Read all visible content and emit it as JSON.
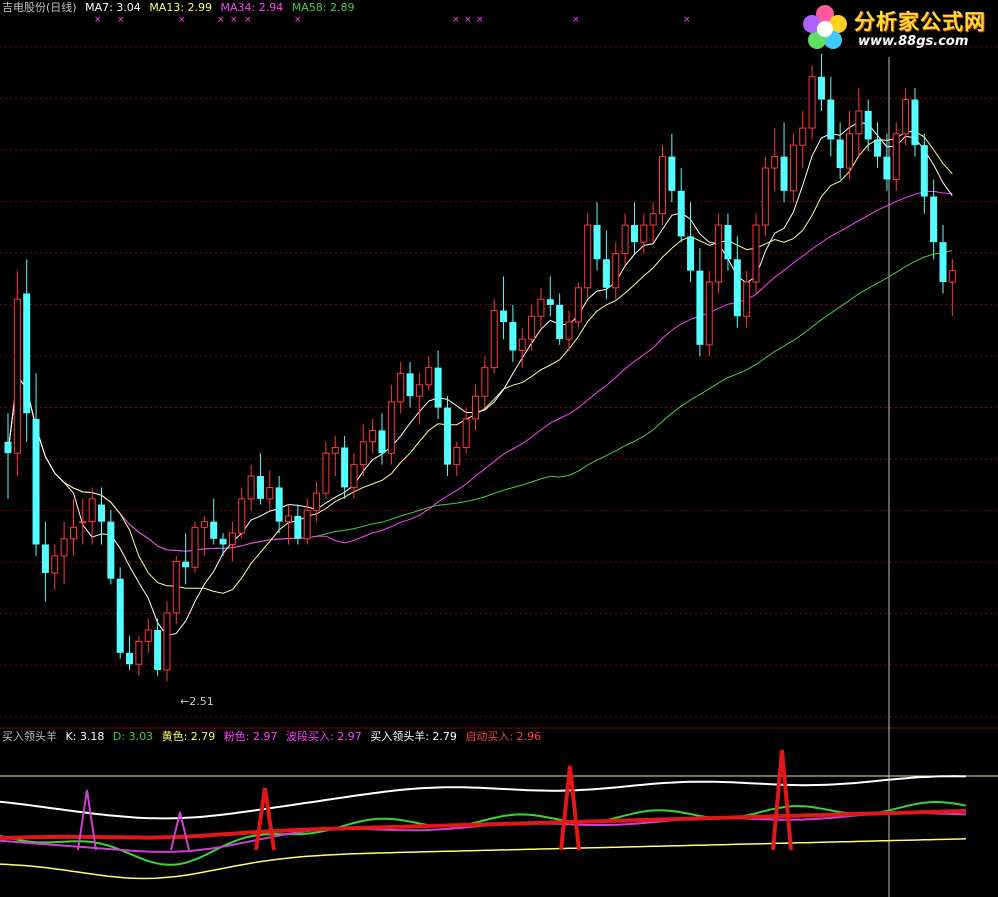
{
  "colors": {
    "up": "#ff3838",
    "down": "#54ffff",
    "ma7": "#ffffff",
    "ma13": "#ffff88",
    "ma34": "#ff40ff",
    "ma58": "#40d040",
    "grid": "#8a0000",
    "white_line": "#ffffff",
    "green_line": "#36d636",
    "yellow_line": "#ffff66",
    "pink_line": "#d040d0",
    "red_line": "#e01818"
  },
  "top_legend": {
    "title": "吉电股份(日线)",
    "ma7_label": "MA7: 3.04",
    "ma13_label": "MA13: 2.99",
    "ma34_label": "MA34: 2.94",
    "ma58_label": "MA58: 2.89"
  },
  "bottom_legend": {
    "name": "买入领头羊",
    "k_label": "K: 3.18",
    "d_label": "D: 3.03",
    "yellow_label": "黄色: 2.79",
    "pink_label": "粉色: 2.97",
    "wave_label": "波段买入: 2.97",
    "leader_label": "买入领头羊: 2.79",
    "start_label": "启动买入: 2.96"
  },
  "logo": {
    "brand": "分析家公式网",
    "url": "www.88gs.com"
  },
  "chart_data": {
    "type": "candlestick",
    "low_marker": "←2.51",
    "candles": [
      [
        2.8,
        2.85,
        2.7,
        2.78
      ],
      [
        2.78,
        3.1,
        2.74,
        3.05
      ],
      [
        3.06,
        3.12,
        2.8,
        2.85
      ],
      [
        2.84,
        2.92,
        2.6,
        2.62
      ],
      [
        2.62,
        2.66,
        2.52,
        2.57
      ],
      [
        2.57,
        2.62,
        2.54,
        2.6
      ],
      [
        2.6,
        2.66,
        2.55,
        2.63
      ],
      [
        2.63,
        2.7,
        2.6,
        2.65
      ],
      [
        2.66,
        2.7,
        2.62,
        2.66
      ],
      [
        2.66,
        2.72,
        2.62,
        2.7
      ],
      [
        2.69,
        2.72,
        2.62,
        2.66
      ],
      [
        2.66,
        2.68,
        2.55,
        2.56
      ],
      [
        2.56,
        2.58,
        2.42,
        2.43
      ],
      [
        2.43,
        2.46,
        2.4,
        2.41
      ],
      [
        2.41,
        2.46,
        2.39,
        2.45
      ],
      [
        2.45,
        2.49,
        2.43,
        2.47
      ],
      [
        2.47,
        2.49,
        2.39,
        2.4
      ],
      [
        2.4,
        2.52,
        2.38,
        2.5
      ],
      [
        2.5,
        2.6,
        2.48,
        2.59
      ],
      [
        2.59,
        2.64,
        2.55,
        2.58
      ],
      [
        2.58,
        2.66,
        2.57,
        2.65
      ],
      [
        2.65,
        2.67,
        2.6,
        2.66
      ],
      [
        2.66,
        2.7,
        2.62,
        2.63
      ],
      [
        2.63,
        2.64,
        2.6,
        2.62
      ],
      [
        2.62,
        2.66,
        2.59,
        2.64
      ],
      [
        2.64,
        2.72,
        2.63,
        2.7
      ],
      [
        2.7,
        2.76,
        2.68,
        2.74
      ],
      [
        2.74,
        2.78,
        2.69,
        2.7
      ],
      [
        2.7,
        2.75,
        2.68,
        2.72
      ],
      [
        2.72,
        2.74,
        2.64,
        2.66
      ],
      [
        2.66,
        2.69,
        2.62,
        2.67
      ],
      [
        2.67,
        2.69,
        2.62,
        2.63
      ],
      [
        2.63,
        2.7,
        2.62,
        2.68
      ],
      [
        2.68,
        2.73,
        2.66,
        2.71
      ],
      [
        2.71,
        2.8,
        2.7,
        2.78
      ],
      [
        2.78,
        2.81,
        2.74,
        2.79
      ],
      [
        2.79,
        2.81,
        2.7,
        2.72
      ],
      [
        2.72,
        2.78,
        2.7,
        2.76
      ],
      [
        2.76,
        2.83,
        2.74,
        2.8
      ],
      [
        2.8,
        2.84,
        2.78,
        2.82
      ],
      [
        2.82,
        2.85,
        2.76,
        2.78
      ],
      [
        2.78,
        2.9,
        2.76,
        2.87
      ],
      [
        2.87,
        2.94,
        2.85,
        2.92
      ],
      [
        2.92,
        2.94,
        2.86,
        2.88
      ],
      [
        2.88,
        2.92,
        2.83,
        2.9
      ],
      [
        2.9,
        2.95,
        2.89,
        2.93
      ],
      [
        2.93,
        2.96,
        2.84,
        2.86
      ],
      [
        2.86,
        2.88,
        2.74,
        2.76
      ],
      [
        2.76,
        2.8,
        2.74,
        2.79
      ],
      [
        2.79,
        2.86,
        2.78,
        2.84
      ],
      [
        2.84,
        2.9,
        2.82,
        2.88
      ],
      [
        2.88,
        2.95,
        2.86,
        2.93
      ],
      [
        2.93,
        3.05,
        2.92,
        3.03
      ],
      [
        3.03,
        3.09,
        2.98,
        3.01
      ],
      [
        3.01,
        3.04,
        2.94,
        2.96
      ],
      [
        2.96,
        3.0,
        2.93,
        2.98
      ],
      [
        2.98,
        3.04,
        2.96,
        3.02
      ],
      [
        3.02,
        3.07,
        3.0,
        3.05
      ],
      [
        3.05,
        3.09,
        3.02,
        3.04
      ],
      [
        3.04,
        3.06,
        2.97,
        2.98
      ],
      [
        2.98,
        3.03,
        2.96,
        3.01
      ],
      [
        3.01,
        3.08,
        3.0,
        3.07
      ],
      [
        3.07,
        3.2,
        3.05,
        3.18
      ],
      [
        3.18,
        3.22,
        3.1,
        3.12
      ],
      [
        3.12,
        3.17,
        3.05,
        3.07
      ],
      [
        3.07,
        3.15,
        3.05,
        3.13
      ],
      [
        3.13,
        3.2,
        3.11,
        3.18
      ],
      [
        3.18,
        3.22,
        3.13,
        3.15
      ],
      [
        3.15,
        3.2,
        3.13,
        3.18
      ],
      [
        3.18,
        3.22,
        3.15,
        3.2
      ],
      [
        3.2,
        3.32,
        3.18,
        3.3
      ],
      [
        3.3,
        3.34,
        3.22,
        3.24
      ],
      [
        3.24,
        3.28,
        3.15,
        3.16
      ],
      [
        3.16,
        3.22,
        3.08,
        3.1
      ],
      [
        3.1,
        3.14,
        2.95,
        2.97
      ],
      [
        2.97,
        3.1,
        2.95,
        3.08
      ],
      [
        3.08,
        3.2,
        3.06,
        3.18
      ],
      [
        3.18,
        3.2,
        3.1,
        3.12
      ],
      [
        3.12,
        3.16,
        3.0,
        3.02
      ],
      [
        3.02,
        3.1,
        3.0,
        3.08
      ],
      [
        3.08,
        3.2,
        3.06,
        3.18
      ],
      [
        3.18,
        3.3,
        3.16,
        3.28
      ],
      [
        3.28,
        3.35,
        3.24,
        3.3
      ],
      [
        3.3,
        3.36,
        3.22,
        3.24
      ],
      [
        3.24,
        3.34,
        3.22,
        3.32
      ],
      [
        3.32,
        3.38,
        3.28,
        3.35
      ],
      [
        3.35,
        3.46,
        3.33,
        3.44
      ],
      [
        3.44,
        3.48,
        3.38,
        3.4
      ],
      [
        3.4,
        3.44,
        3.3,
        3.33
      ],
      [
        3.33,
        3.36,
        3.26,
        3.28
      ],
      [
        3.28,
        3.38,
        3.26,
        3.34
      ],
      [
        3.34,
        3.42,
        3.3,
        3.38
      ],
      [
        3.38,
        3.4,
        3.31,
        3.33
      ],
      [
        3.33,
        3.36,
        3.28,
        3.3
      ],
      [
        3.3,
        3.34,
        3.24,
        3.26
      ],
      [
        3.26,
        3.36,
        3.24,
        3.34
      ],
      [
        3.34,
        3.42,
        3.32,
        3.4
      ],
      [
        3.4,
        3.42,
        3.3,
        3.32
      ],
      [
        3.32,
        3.34,
        3.2,
        3.23
      ],
      [
        3.23,
        3.26,
        3.12,
        3.15
      ],
      [
        3.15,
        3.18,
        3.06,
        3.08
      ],
      [
        3.08,
        3.12,
        3.02,
        3.1
      ]
    ]
  }
}
